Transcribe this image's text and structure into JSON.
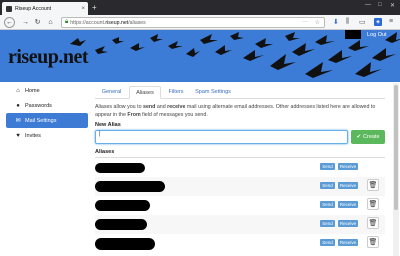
{
  "browser": {
    "tab_title": "Riseup Account",
    "tab_close": "×",
    "new_tab": "+",
    "url_prefix": "https://account.",
    "url_domain": "riseup.net",
    "url_path": "/aliases"
  },
  "header": {
    "logo": "riseup.net",
    "logout": "Log Out"
  },
  "sidebar": {
    "items": [
      {
        "label": "Home",
        "icon": "home-icon"
      },
      {
        "label": "Passwords",
        "icon": "user-icon"
      },
      {
        "label": "Mail Settings",
        "icon": "mail-icon"
      },
      {
        "label": "Invites",
        "icon": "heart-icon"
      }
    ],
    "active_index": 2
  },
  "main": {
    "tabs": [
      {
        "label": "General"
      },
      {
        "label": "Aliases"
      },
      {
        "label": "Filters"
      },
      {
        "label": "Spam Settings"
      }
    ],
    "active_tab": 1,
    "desc_1": "Aliases allow you to ",
    "desc_send": "send",
    "desc_2": " and ",
    "desc_receive": "receive",
    "desc_3": " mail using alternate email addresses. Other addresses listed here are allowed to appear in the ",
    "desc_from": "From",
    "desc_4": " field of messages you send.",
    "new_alias_label": "New Alias",
    "new_alias_value": "",
    "create_label": "Create",
    "aliases_label": "Aliases",
    "send_label": "Send",
    "receive_label": "Receive"
  },
  "colors": {
    "header_blue": "#3c7bd6",
    "active_blue": "#3d7bd5",
    "create_green": "#5cb85c"
  }
}
